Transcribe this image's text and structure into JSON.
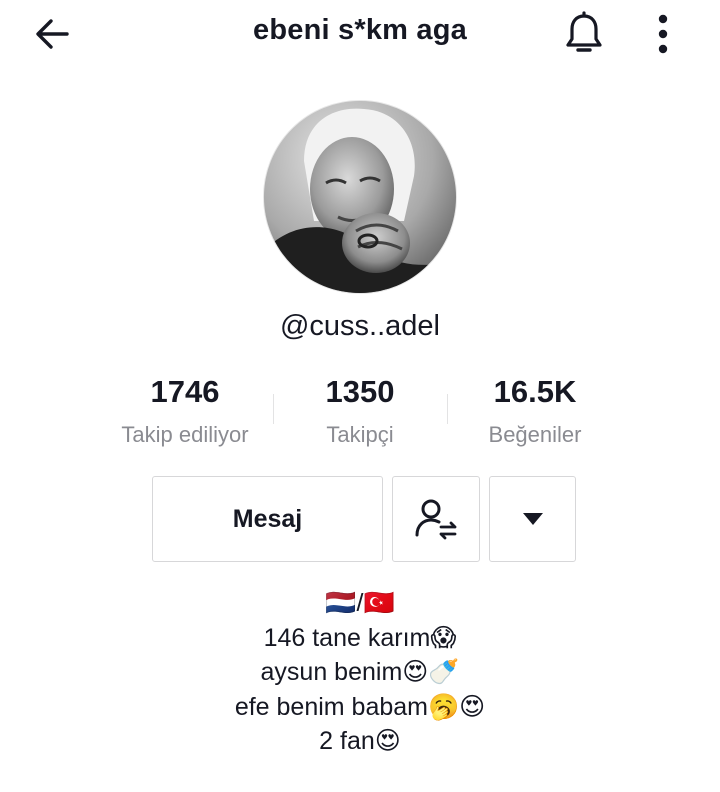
{
  "header": {
    "title": "ebeni s*km aga",
    "back_icon": "arrow-left-icon",
    "bell_icon": "bell-icon",
    "more_icon": "more-vertical-icon"
  },
  "profile": {
    "username": "@cuss..adel"
  },
  "stats": {
    "following": {
      "value": "1746",
      "label": "Takip ediliyor"
    },
    "followers": {
      "value": "1350",
      "label": "Takipçi"
    },
    "likes": {
      "value": "16.5K",
      "label": "Beğeniler"
    }
  },
  "actions": {
    "message_label": "Mesaj",
    "follow_icon": "user-switch-icon",
    "dropdown_icon": "caret-down-icon"
  },
  "bio": {
    "lines": [
      "🇳🇱/🇹🇷",
      "146 tane karım😱",
      "aysun benim😍🍼",
      "efe benim babam🥱😍",
      "2 fan😍"
    ]
  },
  "colors": {
    "text": "#161823",
    "secondary_text": "#8a8b91",
    "border": "#d7d7d9"
  }
}
